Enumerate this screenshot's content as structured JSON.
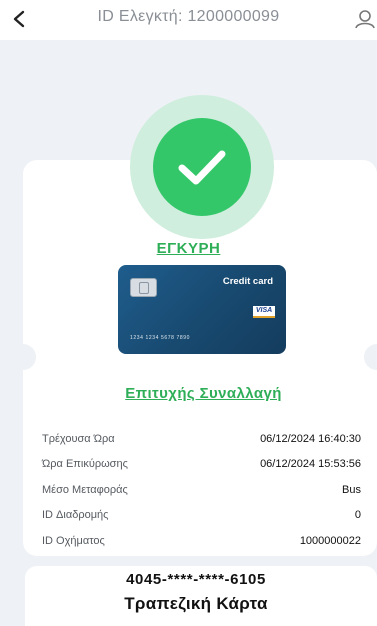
{
  "header": {
    "title": "ID Ελεγκτή:  1200000099",
    "back_icon": "chevron-left-icon",
    "user_icon": "user-icon"
  },
  "status": {
    "label": "ΕΓΚΥΡΗ",
    "icon": "checkmark-icon",
    "color": "#34c76a"
  },
  "card_image": {
    "label": "Credit card",
    "brand": "VISA",
    "number": "1234  1234  5678  7890"
  },
  "transaction": {
    "result": "Επιτυχής Συναλλαγή",
    "rows": [
      {
        "label": "Τρέχουσα Ώρα",
        "value": "06/12/2024 16:40:30"
      },
      {
        "label": "Ώρα Επικύρωσης",
        "value": "06/12/2024 15:53:56"
      },
      {
        "label": "Μέσο Μεταφοράς",
        "value": "Bus"
      },
      {
        "label": "ID Διαδρομής",
        "value": "0"
      },
      {
        "label": "ID Οχήματος",
        "value": "1000000022"
      }
    ]
  },
  "footer": {
    "masked_card": "4045-****-****-6105",
    "card_type": "Τραπεζική Κάρτα"
  }
}
